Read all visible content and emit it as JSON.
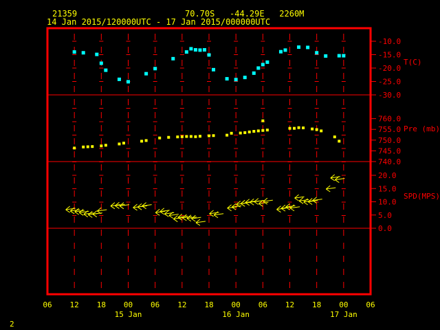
{
  "header": {
    "station": "21359",
    "location": "70.70S   -44.29E   2260M",
    "period": "14 Jan 2015/120000UTC - 17 Jan 2015/000000UTC"
  },
  "page_number": "2",
  "colors": {
    "frame": "#ff0000",
    "axis_text": "#ff0000",
    "time_text": "#ffff00",
    "temperature": "#00ffff",
    "pressure": "#ffff00",
    "wind": "#ffff00"
  },
  "chart_data": [
    {
      "type": "scatter",
      "panel": "temperature",
      "ylabel": "T(C)",
      "ylim": [
        -30,
        -10
      ],
      "yticks": [
        "-10.0",
        "-15.0",
        "-20.0",
        "-25.0",
        "-30.0"
      ],
      "x_hours": [
        12,
        14,
        17,
        18,
        19,
        22,
        24,
        28,
        30,
        34,
        37,
        38,
        39,
        40,
        41,
        42,
        43,
        46,
        48,
        50,
        52,
        53,
        54,
        55,
        58,
        59,
        62,
        64,
        66,
        68,
        71,
        72
      ],
      "values": [
        -14.0,
        -14.3,
        -14.9,
        -18.2,
        -20.8,
        -24.2,
        -25.1,
        -22.1,
        -20.2,
        -16.5,
        -14.0,
        -12.8,
        -13.2,
        -13.3,
        -13.2,
        -15.1,
        -20.6,
        -24.0,
        -24.3,
        -23.5,
        -21.9,
        -20.0,
        -18.7,
        -17.8,
        -13.9,
        -13.3,
        -12.2,
        -12.3,
        -14.3,
        -15.5,
        -15.4,
        -15.4
      ]
    },
    {
      "type": "scatter",
      "panel": "pressure",
      "ylabel": "Pre (mb)",
      "ylim": [
        740,
        765
      ],
      "yticks": [
        "760.0",
        "755.0",
        "750.0",
        "745.0",
        "740.0"
      ],
      "x_hours": [
        12,
        14,
        15,
        16,
        18,
        19,
        22,
        23,
        27,
        28,
        31,
        33,
        35,
        36,
        37,
        38,
        39,
        40,
        42,
        43,
        46,
        47,
        49,
        50,
        51,
        52,
        53,
        54,
        54,
        55,
        60,
        61,
        62,
        63,
        65,
        66,
        67,
        70,
        71
      ],
      "values": [
        746.3,
        746.8,
        746.9,
        747.0,
        747.3,
        747.6,
        748.2,
        748.6,
        749.5,
        749.8,
        751.0,
        751.3,
        751.5,
        751.6,
        751.7,
        751.7,
        751.6,
        751.8,
        752.0,
        752.1,
        752.3,
        753.2,
        753.3,
        753.5,
        753.8,
        754.1,
        754.3,
        754.5,
        759.0,
        754.7,
        755.5,
        755.5,
        755.8,
        755.7,
        755.2,
        754.9,
        754.3,
        751.5,
        749.5
      ]
    },
    {
      "type": "wind_barbs",
      "panel": "wind speed",
      "ylabel": "SPD(MPS)",
      "ylim": [
        0,
        20
      ],
      "yticks": [
        "20.0",
        "15.0",
        "10.0",
        "5.0",
        "0.0"
      ],
      "x_hours": [
        11,
        12,
        13,
        14,
        15,
        16,
        17,
        18,
        21,
        22,
        23,
        26,
        27,
        28,
        31,
        32,
        33,
        34,
        35,
        36,
        37,
        38,
        39,
        40,
        43,
        44,
        47,
        48,
        49,
        50,
        51,
        52,
        53,
        54,
        55,
        58,
        59,
        60,
        61,
        62,
        63,
        64,
        65,
        66,
        69,
        70,
        71
      ],
      "values": [
        7.0,
        6.5,
        6.2,
        5.9,
        5.3,
        5.1,
        5.3,
        6.5,
        8.4,
        8.5,
        8.4,
        7.8,
        8.0,
        8.4,
        5.9,
        6.3,
        5.4,
        4.8,
        3.5,
        4.1,
        3.9,
        3.7,
        3.6,
        2.1,
        5.5,
        5.0,
        7.6,
        8.0,
        9.0,
        9.3,
        9.7,
        9.8,
        10.0,
        9.3,
        10.1,
        7.1,
        7.5,
        8.0,
        7.6,
        11.4,
        10.3,
        9.9,
        10.0,
        10.5,
        14.8,
        19.0,
        18.3
      ]
    }
  ],
  "x_axis": {
    "hour_labels": [
      "06",
      "12",
      "18",
      "00",
      "06",
      "12",
      "18",
      "00",
      "06",
      "12",
      "18",
      "00",
      "06"
    ],
    "date_labels": [
      "15 Jan",
      "16 Jan",
      "17 Jan"
    ],
    "x_range_hours": [
      6,
      78
    ]
  }
}
